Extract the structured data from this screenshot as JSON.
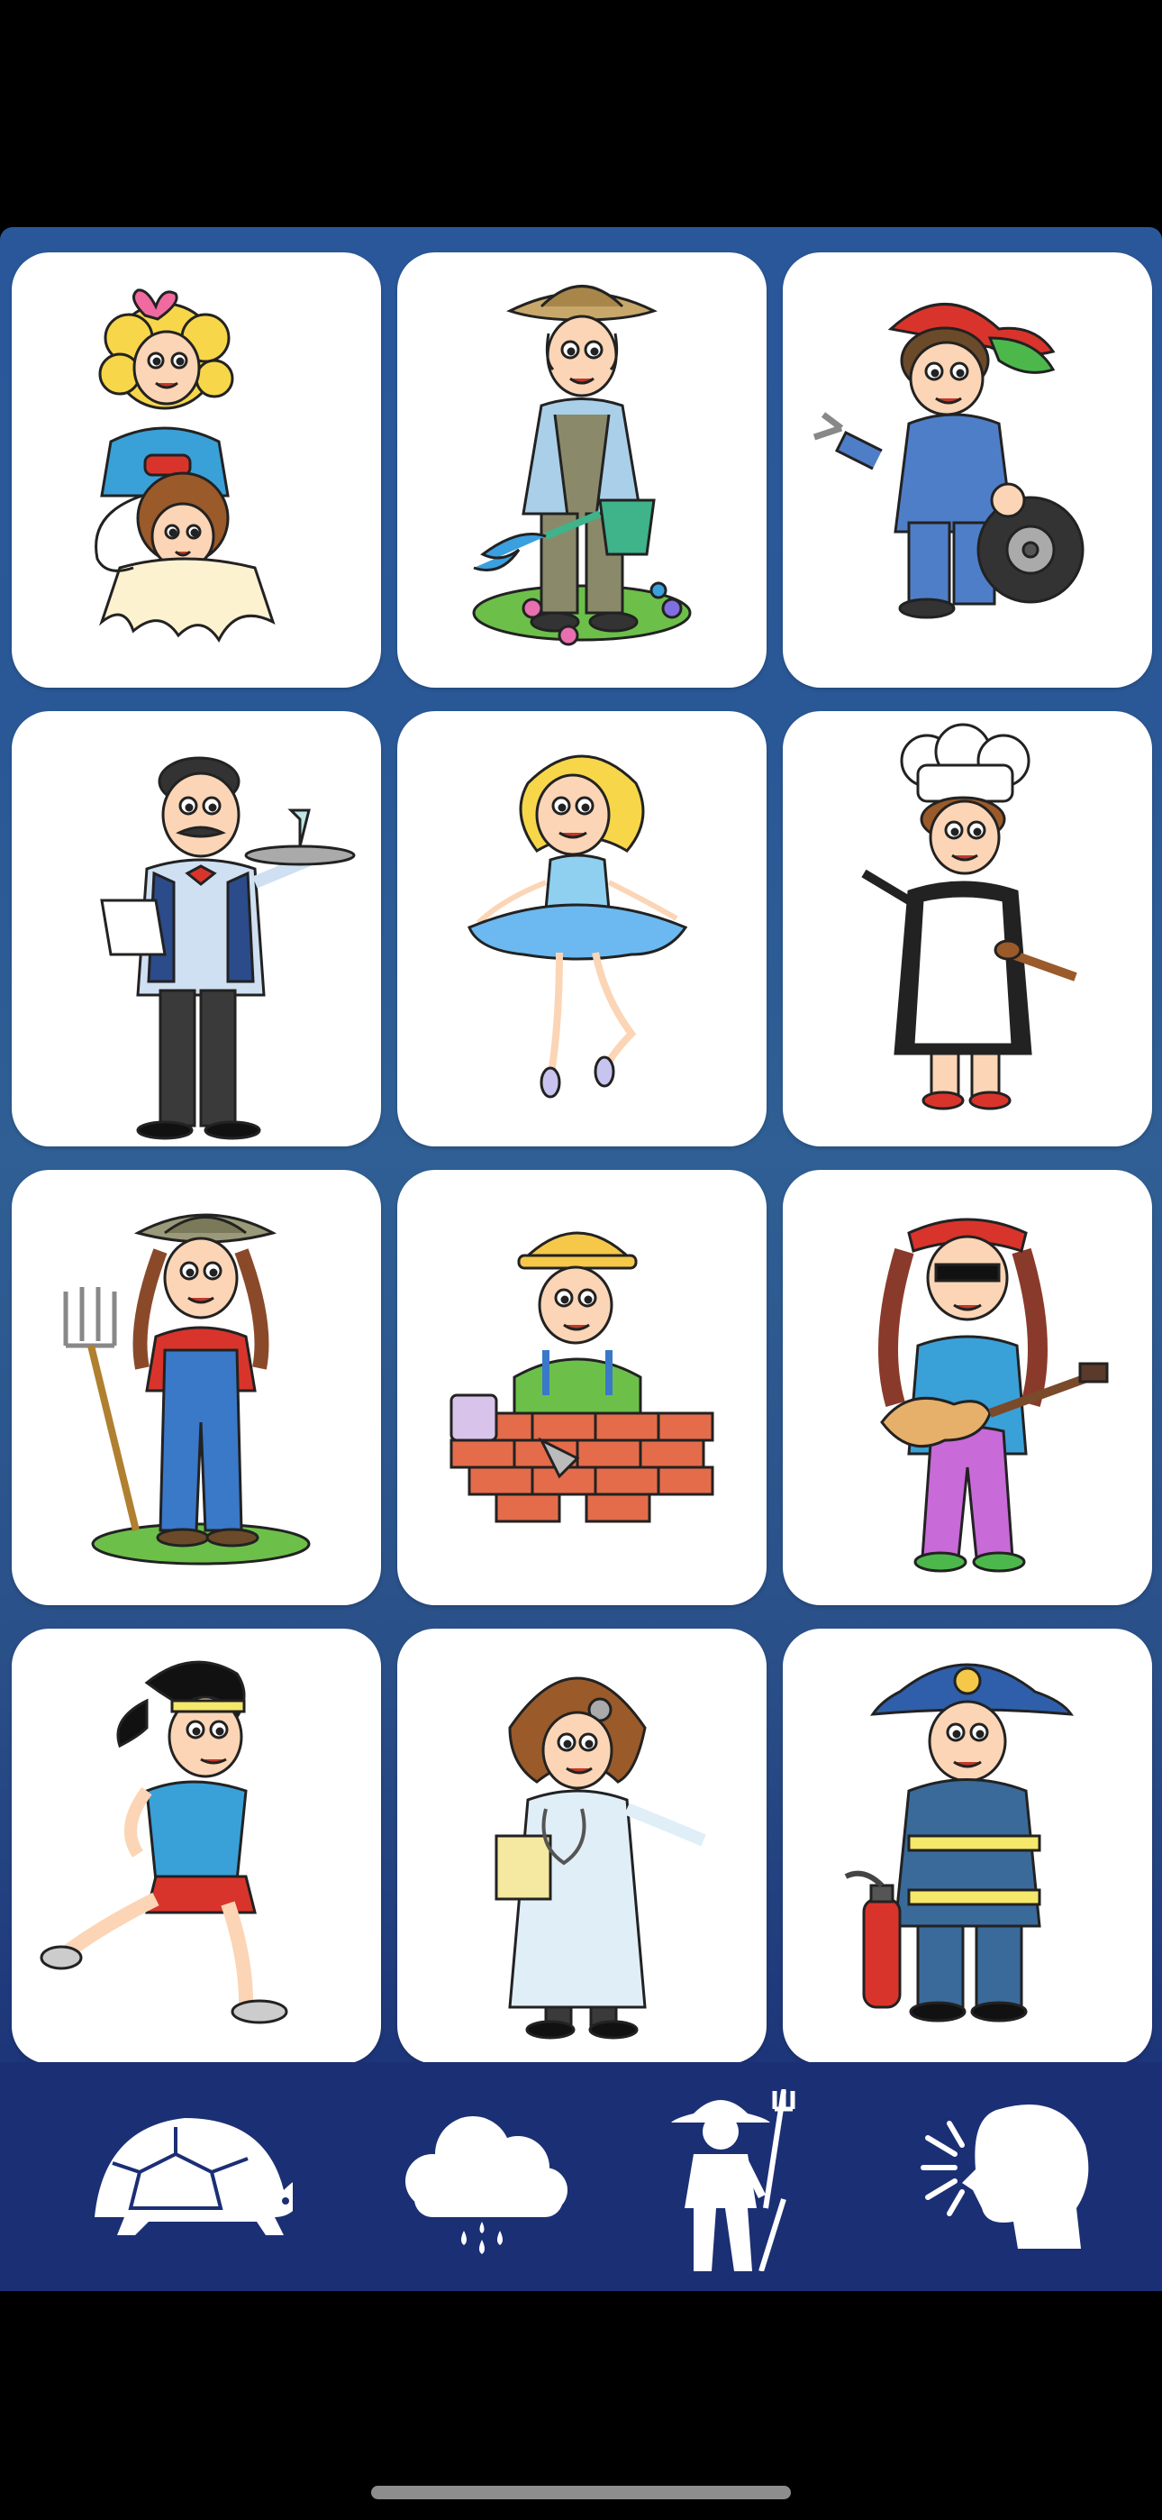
{
  "cards": [
    {
      "icon": "hairdresser-icon"
    },
    {
      "icon": "gardener-icon"
    },
    {
      "icon": "mechanic-icon"
    },
    {
      "icon": "waiter-icon"
    },
    {
      "icon": "ballerina-icon"
    },
    {
      "icon": "cook-icon"
    },
    {
      "icon": "farmer-icon"
    },
    {
      "icon": "bricklayer-icon"
    },
    {
      "icon": "musician-icon"
    },
    {
      "icon": "runner-icon"
    },
    {
      "icon": "doctor-icon"
    },
    {
      "icon": "firefighter-icon"
    }
  ],
  "toolbar": [
    {
      "icon": "turtle-icon"
    },
    {
      "icon": "rain-cloud-icon"
    },
    {
      "icon": "farmer-silhouette-icon"
    },
    {
      "icon": "speaking-head-icon"
    }
  ],
  "colors": {
    "panel": "#2a5896",
    "toolbar": "#1b2f74",
    "card": "#ffffff",
    "background": "#000000"
  }
}
